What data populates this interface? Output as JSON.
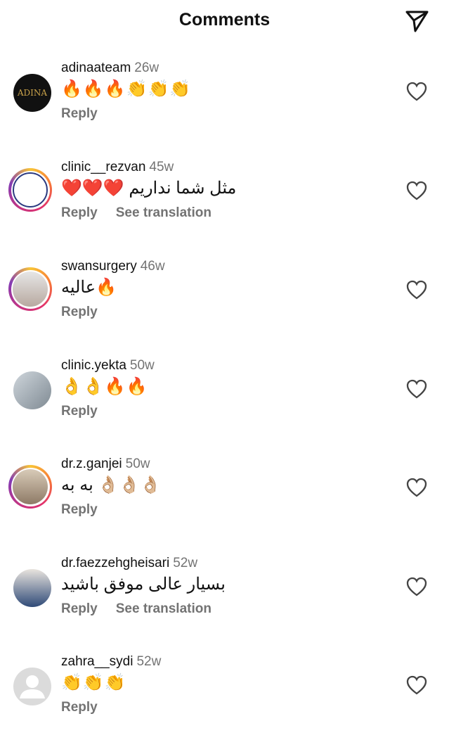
{
  "header": {
    "title": "Comments",
    "share_icon": "paper-plane-icon"
  },
  "comments": [
    {
      "username": "adinaateam",
      "time": "26w",
      "text": "🔥🔥🔥👏👏👏",
      "reply": "Reply",
      "avatar_text": "ADINA"
    },
    {
      "username": "clinic__rezvan",
      "time": "45w",
      "text": "مثل شما نداریم ❤️❤️❤️",
      "reply": "Reply",
      "see_translation": "See translation"
    },
    {
      "username": "swansurgery",
      "time": "46w",
      "text": "عالیه🔥",
      "reply": "Reply"
    },
    {
      "username": "clinic.yekta",
      "time": "50w",
      "text": "👌👌🔥🔥",
      "reply": "Reply"
    },
    {
      "username": "dr.z.ganjei",
      "time": "50w",
      "text": "به به 👌🏼👌🏼👌🏼",
      "reply": "Reply"
    },
    {
      "username": "dr.faezzehgheisari",
      "time": "52w",
      "text": "بسیار عالی موفق باشید",
      "reply": "Reply",
      "see_translation": "See translation"
    },
    {
      "username": "zahra__sydi",
      "time": "52w",
      "text": "👏👏👏",
      "reply": "Reply"
    }
  ]
}
